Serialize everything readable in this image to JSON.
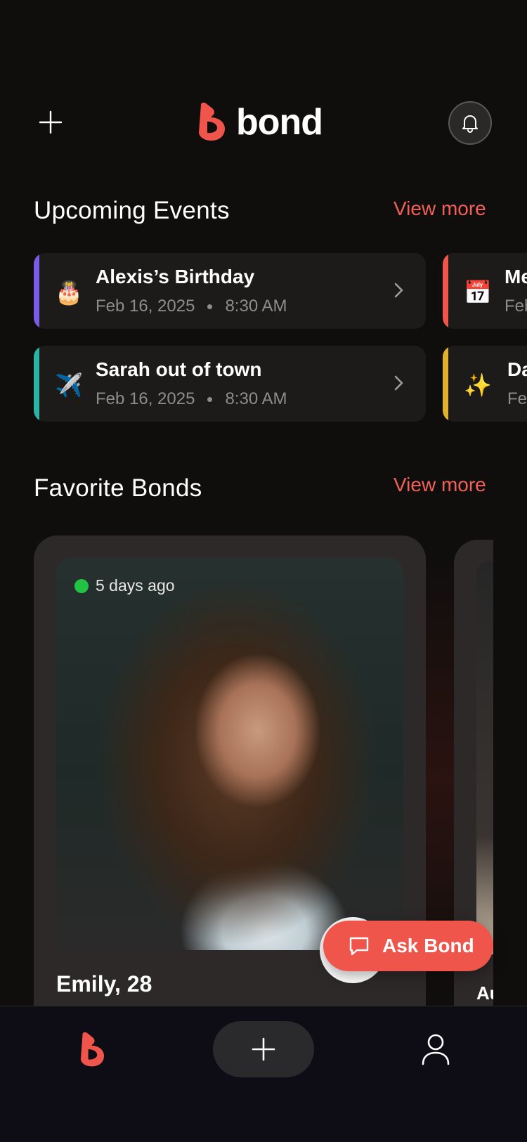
{
  "app": {
    "name": "bond",
    "accent": "#f0554c"
  },
  "header": {
    "add_icon": "plus-icon",
    "logo_icon": "bond-logo-icon",
    "notification_icon": "bell-icon"
  },
  "events": {
    "title": "Upcoming Events",
    "view_more": "View more",
    "items": [
      {
        "emoji": "🎂",
        "title": "Alexis’s Birthday",
        "date": "Feb 16, 2025",
        "time": "8:30 AM",
        "color": "#7b5ce6"
      },
      {
        "emoji": "✈️",
        "title": "Sarah out of town",
        "date": "Feb 16, 2025",
        "time": "8:30 AM",
        "color": "#2bb3a3"
      },
      {
        "emoji": "📅",
        "title": "Me",
        "date": "Feb",
        "color": "#f0554c"
      },
      {
        "emoji": "✨",
        "title": "Da",
        "date": "Fe",
        "color": "#e0b12e"
      }
    ]
  },
  "favorites": {
    "title": "Favorite Bonds",
    "view_more": "View more",
    "cards": [
      {
        "status": "5 days ago",
        "name": "Emily, 28",
        "status_color": "#22c245"
      },
      {
        "name": "Au"
      }
    ]
  },
  "ask_bond": {
    "label": "Ask Bond",
    "icon": "chat-bubble-icon"
  },
  "nav": {
    "home_icon": "bond-logo-icon",
    "add_icon": "plus-icon",
    "profile_icon": "user-icon"
  }
}
